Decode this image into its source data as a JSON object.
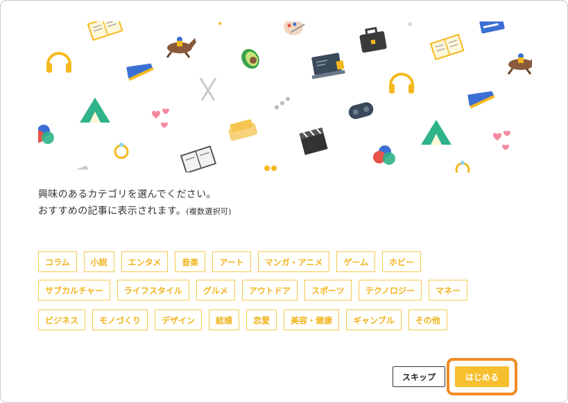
{
  "intro": {
    "line1": "興味のあるカテゴリを選んでください。",
    "line2": "おすすめの記事に表示されます。",
    "line2_note": "(複数選択可)"
  },
  "categories": {
    "row1": [
      "コラム",
      "小説",
      "エンタメ",
      "音楽",
      "アート",
      "マンガ・アニメ",
      "ゲーム",
      "ホビー"
    ],
    "row2": [
      "サブカルチャー",
      "ライフスタイル",
      "グルメ",
      "アウトドア",
      "スポーツ",
      "テクノロジー",
      "マネー"
    ],
    "row3": [
      "ビジネス",
      "モノづくり",
      "デザイン",
      "結婚",
      "恋愛",
      "美容・健康",
      "ギャンブル",
      "その他"
    ]
  },
  "actions": {
    "skip_label": "スキップ",
    "start_label": "はじめる"
  },
  "colors": {
    "accent": "#f6bf2e",
    "category_border": "#f5c84c",
    "category_text": "#f0b41a",
    "highlight_frame": "#f08a24"
  },
  "illustration_icons": [
    "headphones-icon",
    "book-icon",
    "racehorse-icon",
    "sneaker-icon",
    "camping-tent-icon",
    "color-palette-icon",
    "avocado-icon",
    "fork-knife-icon",
    "hearts-icon",
    "ring-icon",
    "laptop-icon",
    "briefcase-icon",
    "game-controller-icon",
    "sofa-icon",
    "clapperboard-icon",
    "newspaper-icon",
    "color-circles-icon",
    "credit-card-icon",
    "dots-icon"
  ]
}
